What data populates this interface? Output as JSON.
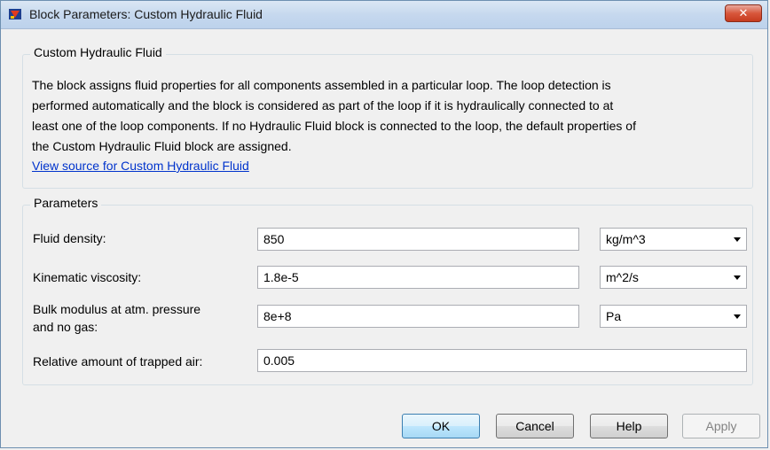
{
  "window": {
    "title": "Block Parameters: Custom Hydraulic Fluid",
    "close_label": "✕"
  },
  "description_group": {
    "title": "Custom Hydraulic Fluid",
    "lines": [
      "The block assigns fluid properties for all components assembled in a particular loop. The loop detection is",
      "performed automatically and the block is considered as part of the loop if it is hydraulically connected to at",
      "least one of the loop components. If no Hydraulic Fluid block is connected to the loop, the default properties of",
      "the Custom Hydraulic Fluid block are assigned."
    ],
    "link": "View source for Custom Hydraulic Fluid"
  },
  "parameters": {
    "title": "Parameters",
    "rows": [
      {
        "label": "Fluid density:",
        "value": "850",
        "unit": "kg/m^3"
      },
      {
        "label": "Kinematic viscosity:",
        "value": "1.8e-5",
        "unit": "m^2/s"
      },
      {
        "label_line1": "Bulk modulus at atm. pressure",
        "label_line2": "and no gas:",
        "value": "8e+8",
        "unit": "Pa"
      },
      {
        "label": "Relative amount of trapped air:",
        "value": "0.005"
      }
    ]
  },
  "buttons": {
    "ok": "OK",
    "cancel": "Cancel",
    "help": "Help",
    "apply": "Apply"
  }
}
